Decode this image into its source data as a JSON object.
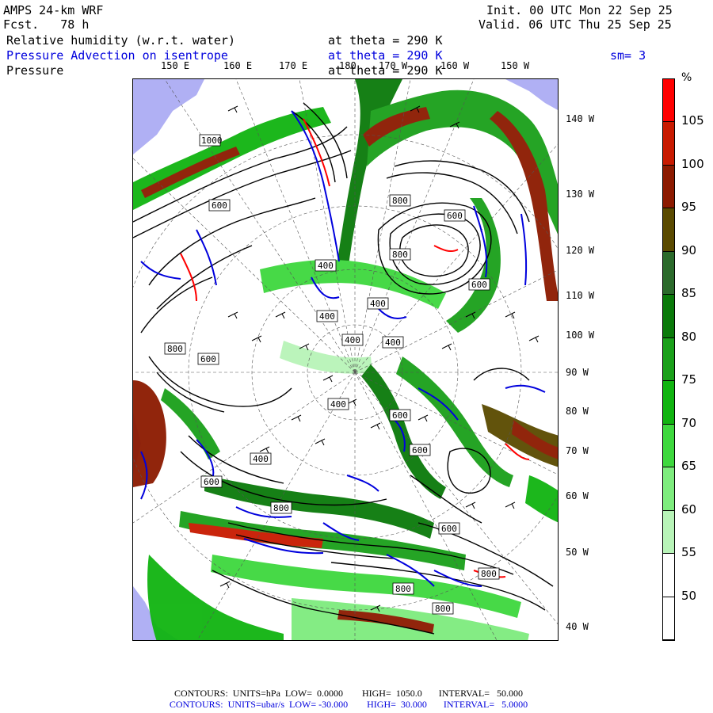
{
  "header": {
    "model": "AMPS 24-km WRF",
    "forecast": "Fcst.   78 h",
    "init": "Init. 00 UTC Mon 22 Sep 25",
    "valid": "Valid. 06 UTC Thu 25 Sep 25",
    "field1_name": "Relative humidity (w.r.t. water)",
    "field1_level": "at theta = 290 K",
    "field2_name": "Pressure Advection on isentrope",
    "field2_level": "at theta = 290 K",
    "field2_smooth": "sm= 3",
    "field3_name": "Pressure",
    "field3_level": "at theta = 290 K"
  },
  "map": {
    "lon_labels": [
      "150 E",
      "160 E",
      "170 E",
      "180",
      "170 W",
      "160 W",
      "150 W"
    ],
    "lat_labels": [
      "140 W",
      "130 W",
      "120 W",
      "110 W",
      "100 W",
      "90 W",
      "80 W",
      "70 W",
      "60 W",
      "50 W",
      "40 W"
    ],
    "pressure_contour_labels": [
      "1000",
      "600",
      "800",
      "600",
      "800",
      "400",
      "600",
      "400",
      "800",
      "600",
      "400",
      "400",
      "400",
      "400",
      "600",
      "600",
      "400",
      "800",
      "600",
      "600",
      "800",
      "800",
      "800"
    ],
    "colors": {
      "ice": "#b0b0f4",
      "land_bg": "#ffffff",
      "rh_55": "#b8f4b8",
      "rh_60": "#7eec7e",
      "rh_65": "#3ed83e",
      "rh_70": "#10b410",
      "rh_75": "#1aa01a",
      "rh_80": "#0a7a0a",
      "rh_85": "#2b6a2b",
      "rh_90": "#4a5a10",
      "rh_95": "#5a4a00",
      "rh_100": "#8c1a00",
      "rh_105": "#c81a00",
      "rh_max": "#ff0000",
      "pressure_contour": "#000000",
      "advection_contour": "#0000dd",
      "advection_positive": "#ff0000"
    }
  },
  "colorbar": {
    "unit": "%",
    "ticks": [
      "105",
      "100",
      "95",
      "90",
      "85",
      "80",
      "75",
      "70",
      "65",
      "60",
      "55",
      "50"
    ],
    "segments": [
      "#ff0000",
      "#c81a00",
      "#8c1a00",
      "#5a4a00",
      "#2b6a2b",
      "#0a7a0a",
      "#1aa01a",
      "#10b410",
      "#3ed83e",
      "#7eec7e",
      "#b8f4b8",
      "#ffffff",
      "#ffffff"
    ]
  },
  "footer": {
    "line1": "CONTOURS:  UNITS=hPa  LOW=  0.0000        HIGH=  1050.0       INTERVAL=   50.000",
    "line2": "CONTOURS:  UNITS=ubar/s  LOW= -30.000        HIGH=  30.000       INTERVAL=   5.0000"
  }
}
